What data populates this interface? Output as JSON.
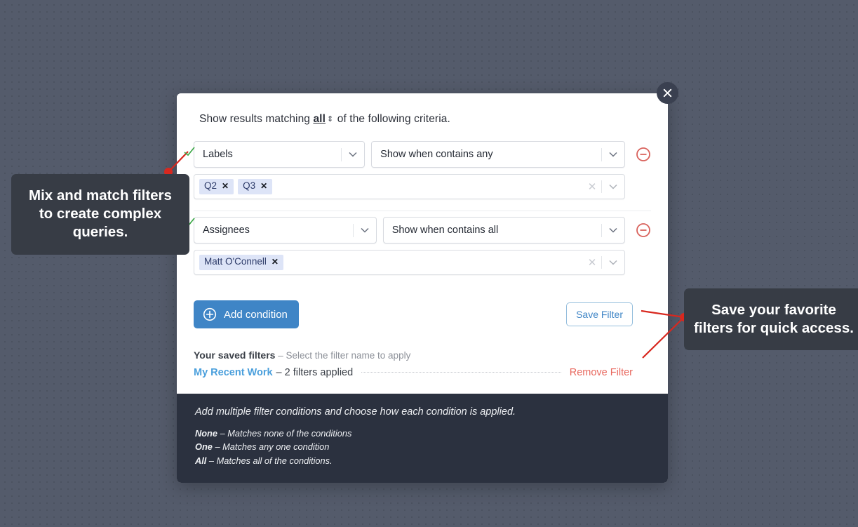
{
  "close_button": {
    "icon": "close-icon",
    "label": "Close"
  },
  "modal": {
    "criteria": {
      "prefix": "Show results matching",
      "match_value": "all",
      "suffix": "of the following criteria.",
      "spinner_glyph": "⇕"
    },
    "conditions": [
      {
        "field": "Labels",
        "operator": "Show when contains any",
        "tags": [
          "Q2",
          "Q3"
        ],
        "tag_remove_glyph": "✕",
        "clear_glyph": "✕",
        "remove_condition_label": "Remove condition"
      },
      {
        "field": "Assignees",
        "operator": "Show when contains all",
        "tags": [
          "Matt O'Connell"
        ],
        "tag_remove_glyph": "✕",
        "clear_glyph": "✕",
        "remove_condition_label": "Remove condition"
      }
    ],
    "actions": {
      "add_condition": "Add condition",
      "save_filter": "Save Filter"
    },
    "saved_filters": {
      "heading": "Your saved filters",
      "heading_hint": "– Select the filter name to apply",
      "rows": [
        {
          "name": "My Recent Work",
          "detail": "– 2 filters applied",
          "remove_label": "Remove Filter"
        }
      ]
    },
    "footer": {
      "lead": "Add multiple filter conditions and choose how each condition is applied.",
      "lines": [
        {
          "term": "None",
          "desc": "– Matches none of the conditions"
        },
        {
          "term": "One",
          "desc": "– Matches any one condition"
        },
        {
          "term": "All",
          "desc": "– Matches all of the conditions."
        }
      ]
    }
  },
  "callouts": {
    "left": "Mix and match filters to create complex queries.",
    "right": "Save your favorite filters for quick access."
  },
  "colors": {
    "background": "#545b6b",
    "accent_blue": "#3f85c6",
    "link_blue": "#4a9fdc",
    "danger_red": "#e8685e",
    "annotation_red": "#d8281f",
    "check_green": "#3fa94a",
    "tag_bg": "#dde4f7",
    "footer_bg": "#2b313f",
    "callout_bg": "#373c45"
  }
}
